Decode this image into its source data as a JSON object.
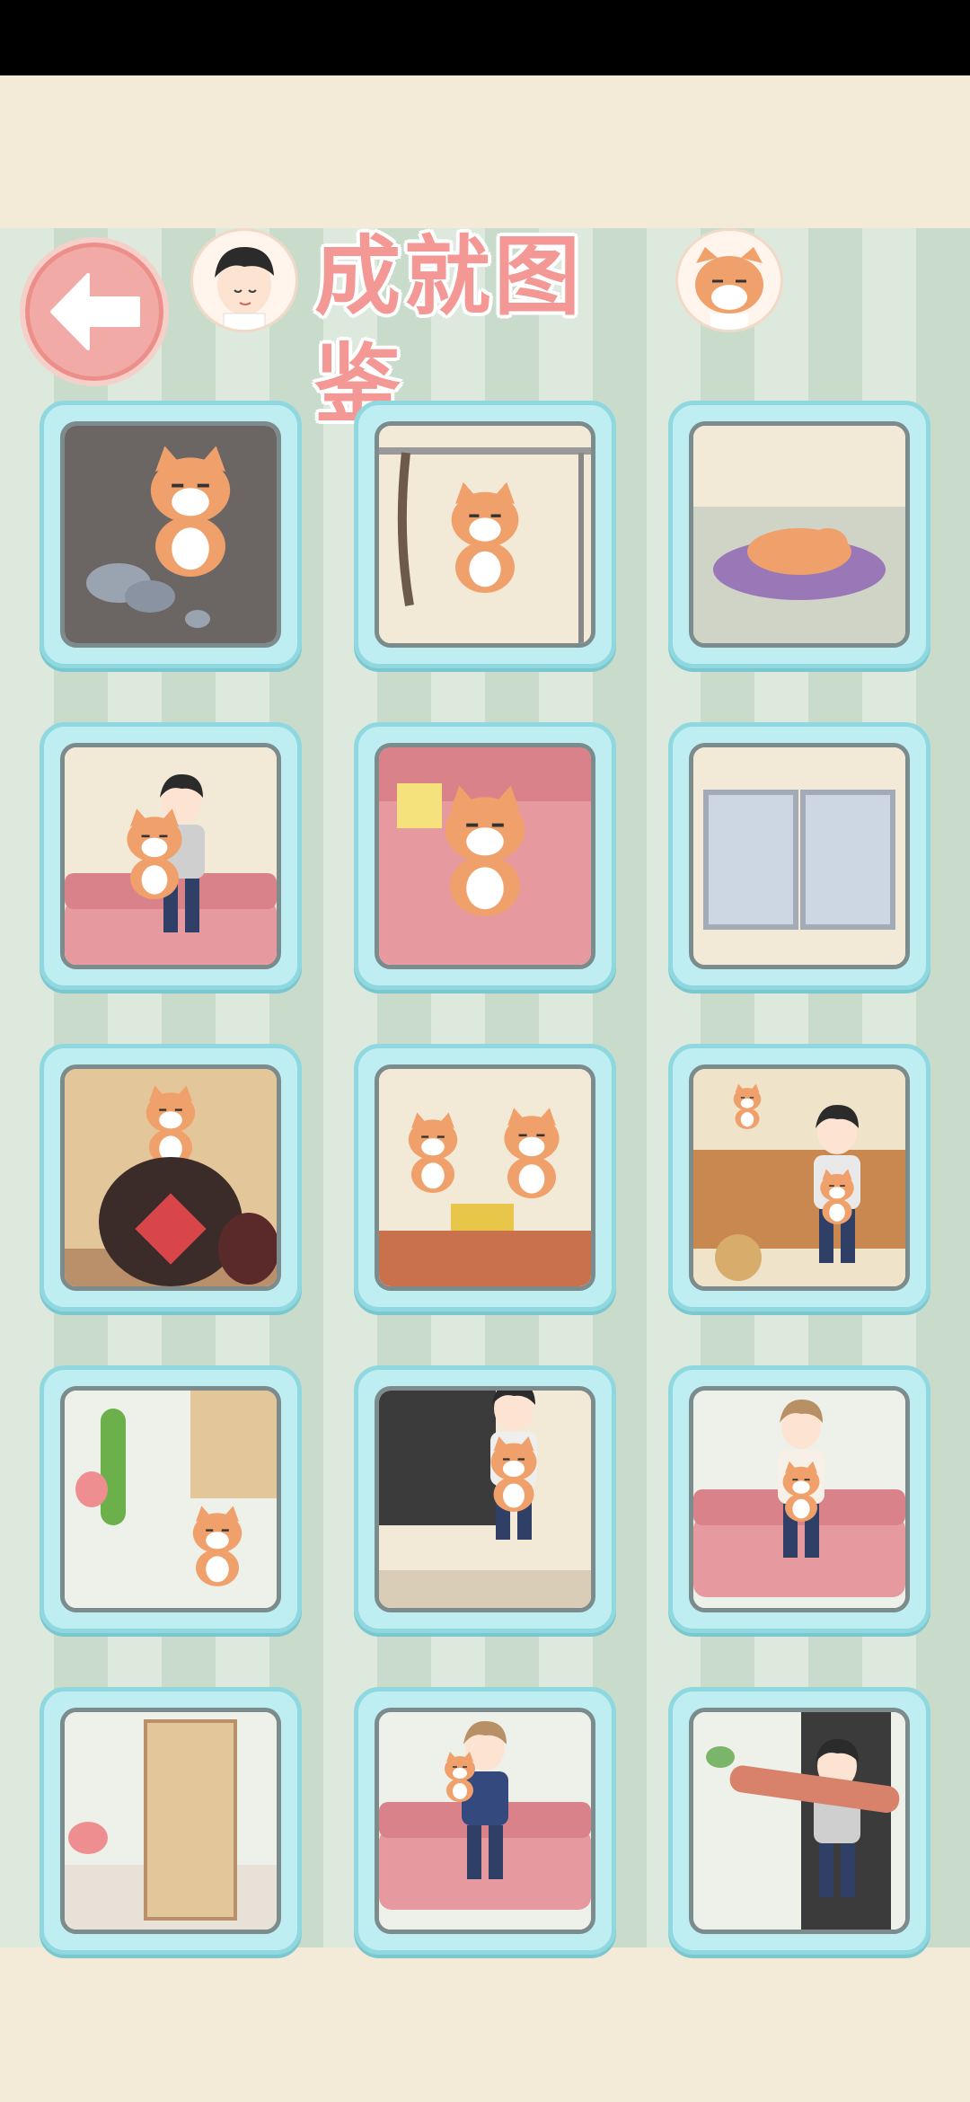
{
  "header": {
    "title": "成就图鉴",
    "back_icon": "arrow-left-icon"
  },
  "achievements": [
    {
      "scene": "cat-catching-mice"
    },
    {
      "scene": "cat-hanging-from-bar"
    },
    {
      "scene": "cat-sleeping-on-cushion"
    },
    {
      "scene": "boy-hugging-cat"
    },
    {
      "scene": "cat-sitting-on-sofa"
    },
    {
      "scene": "empty-window"
    },
    {
      "scene": "cat-in-wine-jar"
    },
    {
      "scene": "lucky-cat-statue"
    },
    {
      "scene": "boy-holding-cat-shop"
    },
    {
      "scene": "cucumber-scaring-cat"
    },
    {
      "scene": "boy-holding-cat-door"
    },
    {
      "scene": "woman-with-cat-sofa"
    },
    {
      "scene": "empty-room-screen"
    },
    {
      "scene": "woman-cat-on-shoulder"
    },
    {
      "scene": "cat-stretching-door"
    }
  ],
  "colors": {
    "accent": "#f39894",
    "card_border": "#8fd8df",
    "card_fill": "#bfeef2",
    "cat_orange": "#f0a06a"
  }
}
